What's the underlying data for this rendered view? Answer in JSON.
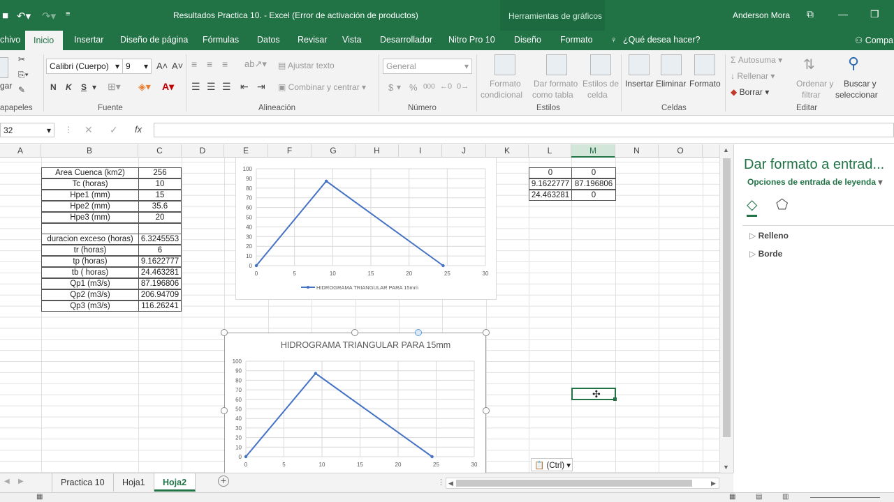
{
  "titlebar": {
    "title": "Resultados Practica 10. - Excel (Error de activación de productos)",
    "context_tools": "Herramientas de gráficos",
    "user": "Anderson Mora"
  },
  "tabs": [
    "chivo",
    "Inicio",
    "Insertar",
    "Diseño de página",
    "Fórmulas",
    "Datos",
    "Revisar",
    "Vista",
    "Desarrollador",
    "Nitro Pro 10",
    "Diseño",
    "Formato"
  ],
  "tell_me": "¿Qué desea hacer?",
  "share": "Compa",
  "ribbon": {
    "clipboard": {
      "paste": "gar",
      "label": "apapeles"
    },
    "font": {
      "name": "Calibri (Cuerpo)",
      "size": "9",
      "bold": "N",
      "italic": "K",
      "underline": "S",
      "label": "Fuente"
    },
    "alignment": {
      "wrap": "Ajustar texto",
      "merge": "Combinar y centrar",
      "label": "Alineación"
    },
    "number": {
      "format": "General",
      "currency": "$",
      "percent": "%",
      "thousands": "000",
      "label": "Número"
    },
    "styles": {
      "cond_line1": "Formato",
      "cond_line2": "condicional",
      "table_line1": "Dar formato",
      "table_line2": "como tabla",
      "cell_line1": "Estilos de",
      "cell_line2": "celda",
      "label": "Estilos"
    },
    "cells": {
      "insert": "Insertar",
      "delete": "Eliminar",
      "format": "Formato",
      "label": "Celdas"
    },
    "editing": {
      "autosum": "Autosuma",
      "fill": "Rellenar",
      "clear": "Borrar",
      "sort_line1": "Ordenar y",
      "sort_line2": "filtrar",
      "find_line1": "Buscar y",
      "find_line2": "seleccionar",
      "label": "Editar"
    }
  },
  "formula_bar": {
    "namebox": "32",
    "fx": "fx",
    "content": ""
  },
  "columns": [
    "A",
    "B",
    "C",
    "D",
    "E",
    "F",
    "G",
    "H",
    "I",
    "J",
    "K",
    "L",
    "M",
    "N",
    "O"
  ],
  "selected_column": "M",
  "table": [
    {
      "label": "Area Cuenca (km2)",
      "value": "256"
    },
    {
      "label": "Tc (horas)",
      "value": "10"
    },
    {
      "label": "Hpe1  (mm)",
      "value": "15"
    },
    {
      "label": "Hpe2  (mm)",
      "value": "35.6"
    },
    {
      "label": "Hpe3  (mm)",
      "value": "20"
    },
    {
      "label": "",
      "value": ""
    },
    {
      "label": "duracion exceso (horas)",
      "value": "6.3245553"
    },
    {
      "label": "tr (horas)",
      "value": "6"
    },
    {
      "label": "tp (horas)",
      "value": "9.1622777"
    },
    {
      "label": "tb ( horas)",
      "value": "24.463281"
    },
    {
      "label": "Qp1 (m3/s)",
      "value": "87.196806"
    },
    {
      "label": "Qp2 (m3/s)",
      "value": "206.94709"
    },
    {
      "label": "Qp3 (m3/s)",
      "value": "116.26241"
    }
  ],
  "lm_table": [
    [
      "0",
      "0"
    ],
    [
      "9.1622777",
      "87.196806"
    ],
    [
      "24.463281",
      "0"
    ]
  ],
  "chart_data": [
    {
      "type": "line",
      "title": "",
      "x": [
        0,
        9.1622777,
        24.463281
      ],
      "series": [
        {
          "name": "HIDROGRAMA TRIANGULAR PARA 15mm",
          "values": [
            0,
            87.196806,
            0
          ]
        }
      ],
      "xlim": [
        0,
        30
      ],
      "ylim": [
        0,
        100
      ],
      "xticks": [
        0,
        5,
        10,
        15,
        20,
        25,
        30
      ],
      "yticks": [
        0,
        10,
        20,
        30,
        40,
        50,
        60,
        70,
        80,
        90,
        100
      ],
      "legend": "bottom",
      "grid": true,
      "color": "#4472c4"
    },
    {
      "type": "line",
      "title": "HIDROGRAMA TRIANGULAR PARA 15mm",
      "x": [
        0,
        9.1622777,
        24.463281
      ],
      "series": [
        {
          "values": [
            0,
            87.196806,
            0
          ]
        }
      ],
      "xlim": [
        0,
        30
      ],
      "ylim": [
        0,
        100
      ],
      "xticks": [
        0,
        5,
        10,
        15,
        20,
        25,
        30
      ],
      "yticks": [
        0,
        10,
        20,
        30,
        40,
        50,
        60,
        70,
        80,
        90,
        100
      ],
      "legend": "none",
      "grid": true,
      "color": "#4472c4"
    }
  ],
  "pane": {
    "title": "Dar formato a entrad...",
    "options": "Opciones de entrada de leyenda",
    "sections": [
      "Relleno",
      "Borde"
    ]
  },
  "sheets": [
    "Practica 10",
    "Hoja1",
    "Hoja2"
  ],
  "active_sheet": "Hoja2",
  "paste_options": "(Ctrl)"
}
